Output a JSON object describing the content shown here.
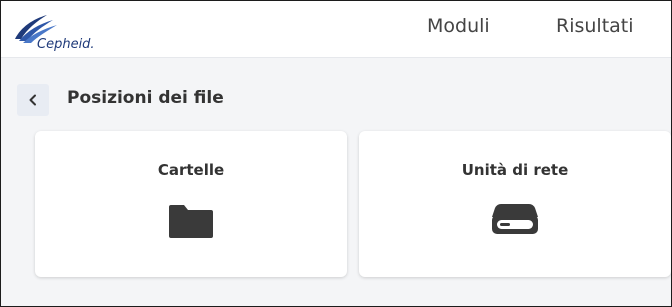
{
  "app": {
    "logo_text": "Cepheid."
  },
  "nav": {
    "items": [
      {
        "label": "Moduli"
      },
      {
        "label": "Risultati"
      }
    ]
  },
  "page": {
    "title": "Posizioni dei file",
    "back_icon": "chevron-left-icon"
  },
  "cards": [
    {
      "label": "Cartelle",
      "icon": "folder-icon"
    },
    {
      "label": "Unità di rete",
      "icon": "hard-drive-icon"
    }
  ],
  "colors": {
    "brand": "#1f3a7a",
    "icon": "#3a3a3a",
    "back_button_bg": "#e8ecf3"
  }
}
